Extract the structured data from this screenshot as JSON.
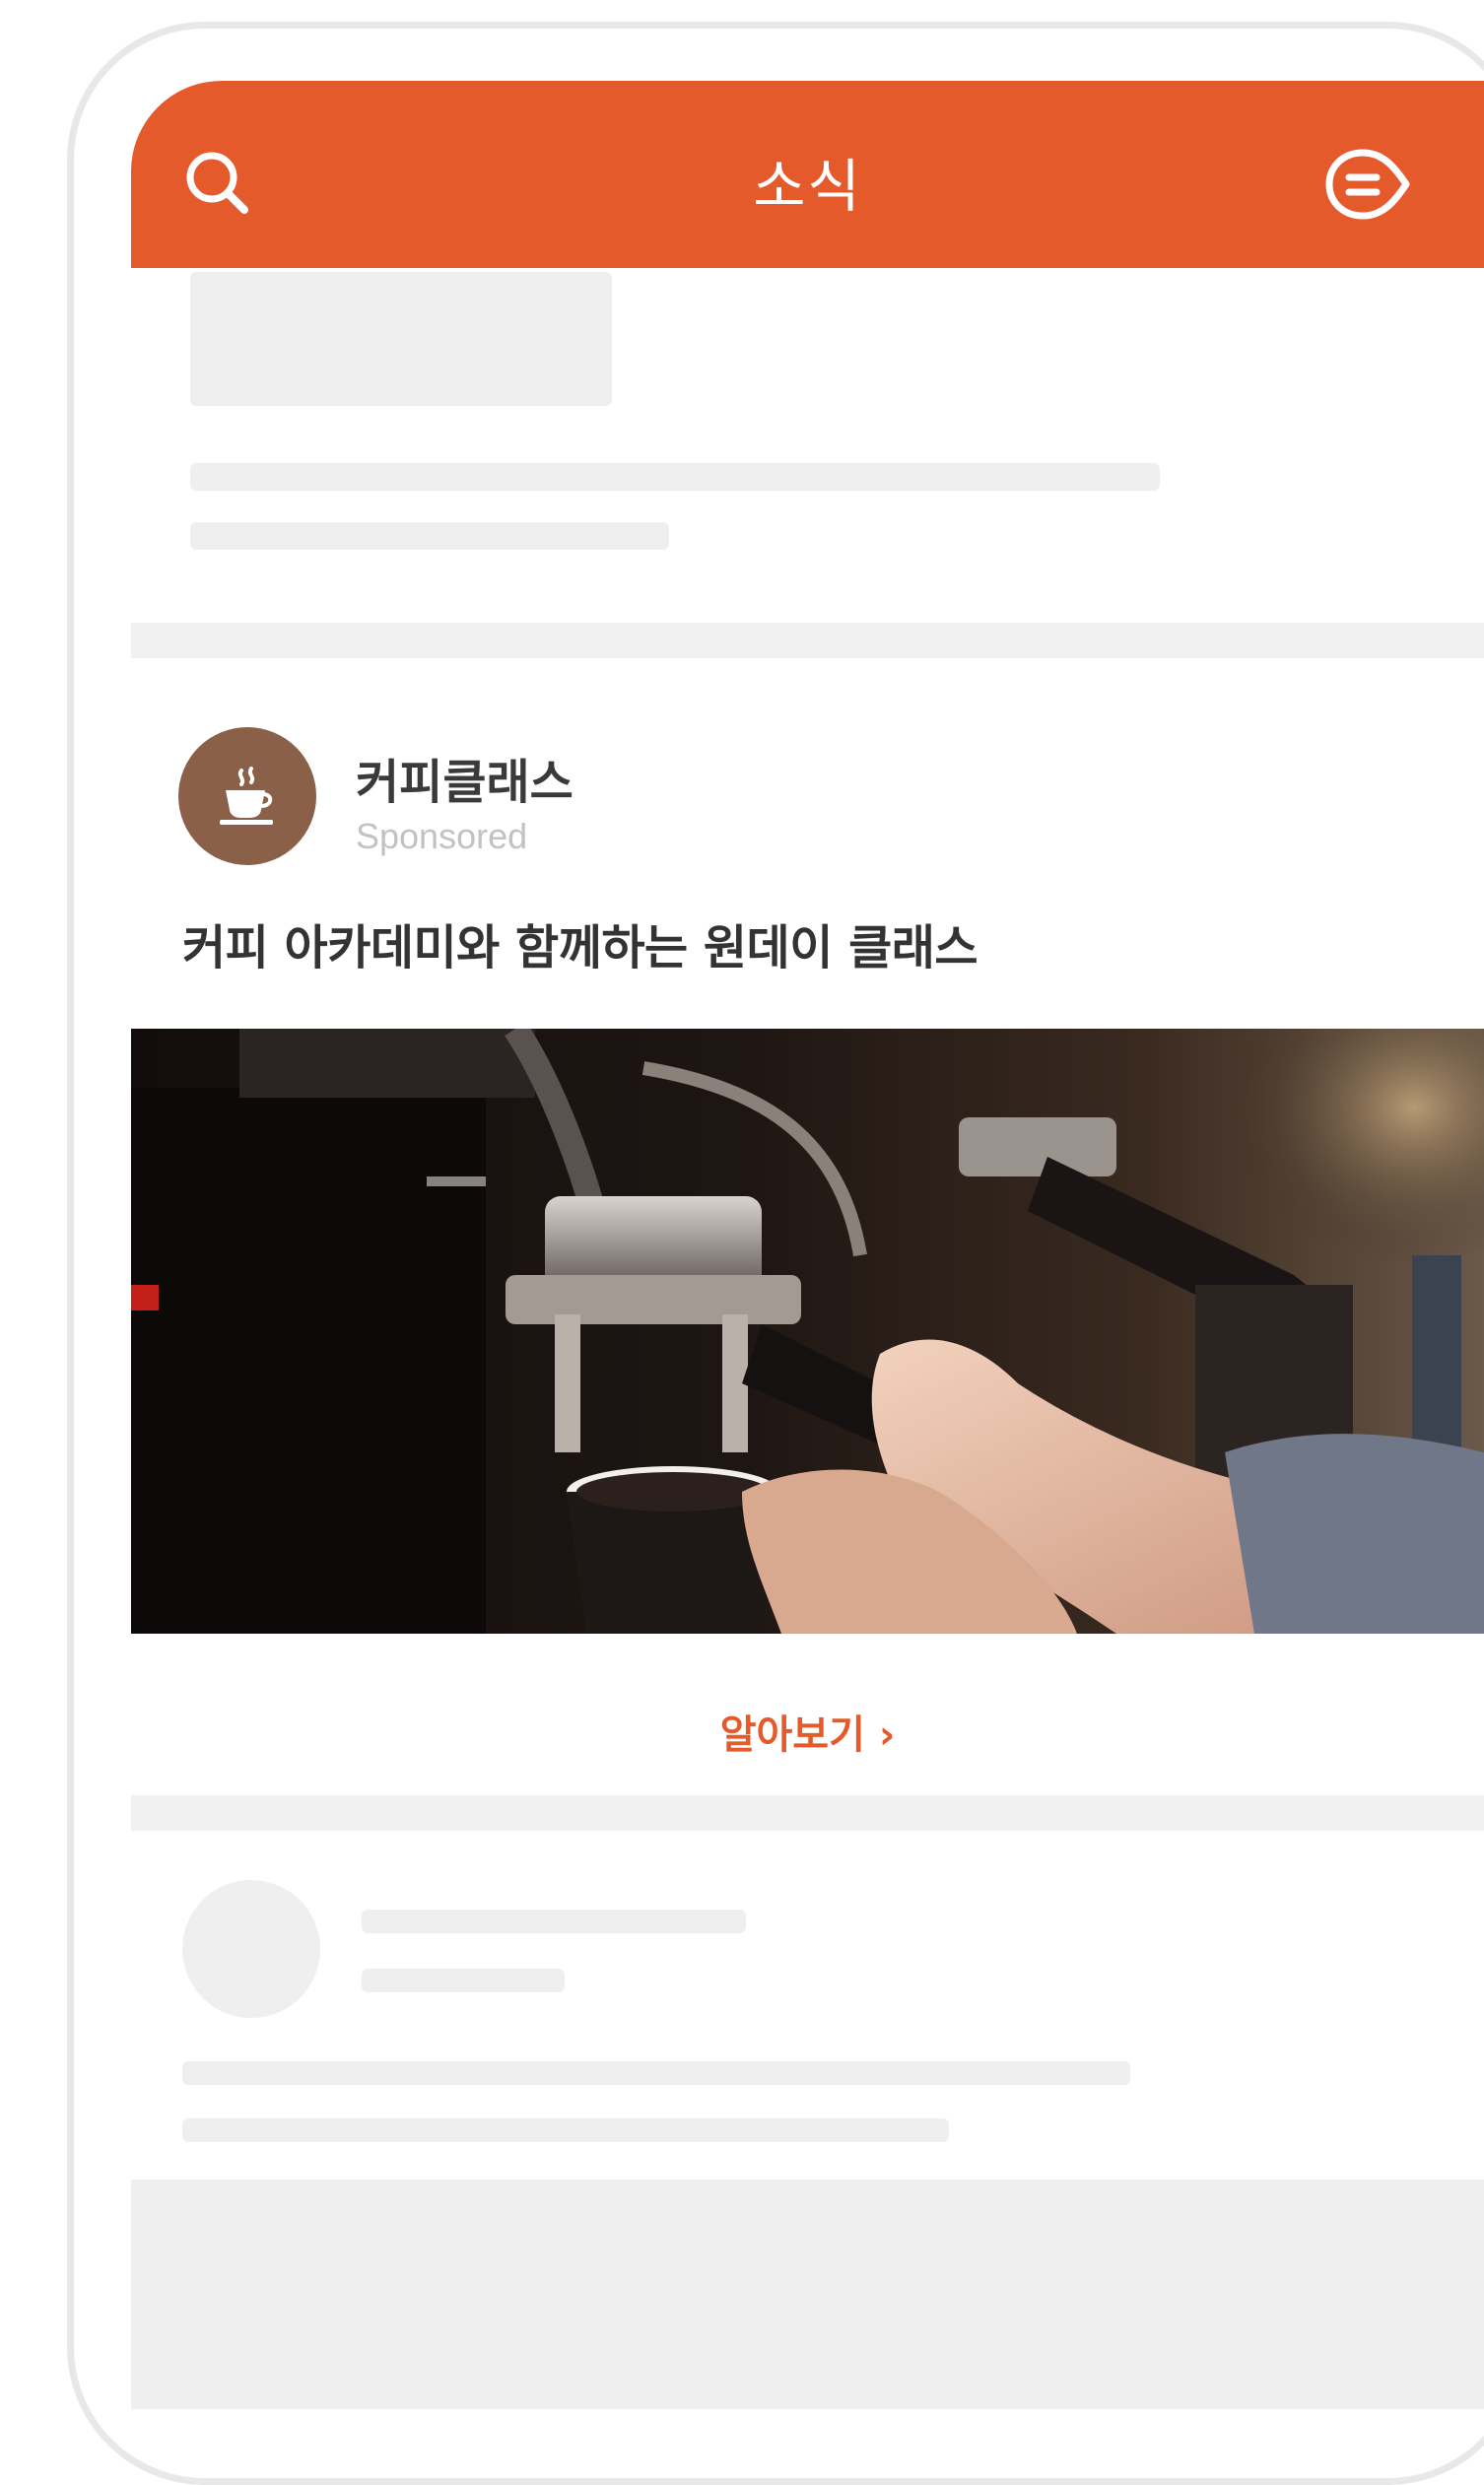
{
  "header": {
    "title": "소식",
    "left_icon": "search-icon",
    "right_icon": "menu-bubble-icon",
    "color": "#e55a2b"
  },
  "ad_post": {
    "sponsor_name": "커피클래스",
    "sponsor_label": "Sponsored",
    "avatar_icon": "coffee-cup-icon",
    "avatar_color": "#8a6049",
    "headline": "커피 아카데미와 함께하는 원데이 클래스",
    "image_alt": "espresso-machine-photo",
    "cta_label": "알아보기 ›"
  }
}
